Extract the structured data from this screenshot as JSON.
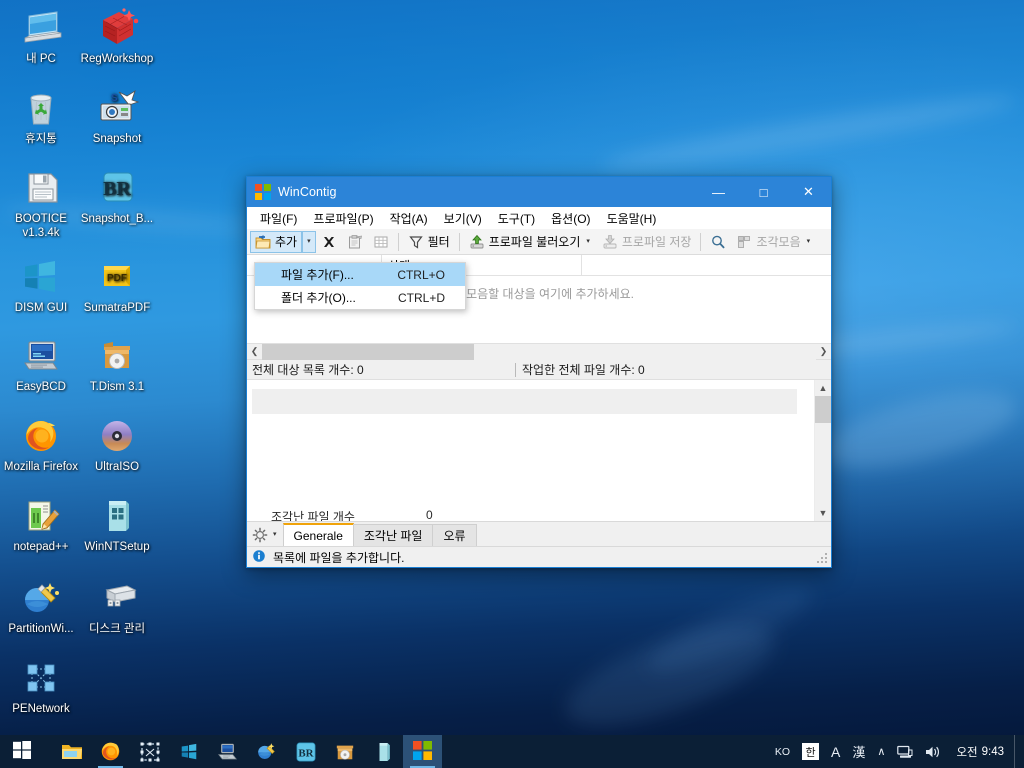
{
  "desktop": {
    "icons": [
      {
        "label": "내 PC",
        "icon": "computer-icon"
      },
      {
        "label": "RegWorkshop",
        "icon": "regworkshop-icon"
      },
      {
        "label": "휴지통",
        "icon": "recycle-bin-icon"
      },
      {
        "label": "Snapshot",
        "icon": "snapshot-icon"
      },
      {
        "label": "BOOTICE v1.3.4k",
        "icon": "bootice-icon"
      },
      {
        "label": "Snapshot_B...",
        "icon": "snapshot-br-icon"
      },
      {
        "label": "DISM GUI",
        "icon": "dism-gui-icon"
      },
      {
        "label": "SumatraPDF",
        "icon": "sumatrapdf-icon"
      },
      {
        "label": "EasyBCD",
        "icon": "easybcd-icon"
      },
      {
        "label": "T.Dism 3.1",
        "icon": "tdism-icon"
      },
      {
        "label": "Mozilla Firefox",
        "icon": "firefox-icon"
      },
      {
        "label": "UltraISO",
        "icon": "ultraiso-icon"
      },
      {
        "label": "notepad++",
        "icon": "notepadpp-icon"
      },
      {
        "label": "WinNTSetup",
        "icon": "winntsetup-icon"
      },
      {
        "label": "PartitionWi...",
        "icon": "partitionwizard-icon"
      },
      {
        "label": "디스크 관리",
        "icon": "disk-management-icon"
      },
      {
        "label": "PENetwork",
        "icon": "penetwork-icon"
      }
    ]
  },
  "window": {
    "title": "WinContig",
    "controls": {
      "minimize": "—",
      "maximize": "□",
      "close": "✕"
    },
    "menubar": [
      "파일(F)",
      "프로파일(P)",
      "작업(A)",
      "보기(V)",
      "도구(T)",
      "옵션(O)",
      "도움말(H)"
    ],
    "toolbar": {
      "add_label": "추가",
      "filter_label": "필터",
      "load_profile_label": "프로파일 불러오기",
      "save_profile_label": "프로파일 저장",
      "defrag_label": "조각모음",
      "caret": "▾"
    },
    "dropdown": {
      "items": [
        {
          "label": "파일 추가(F)...",
          "shortcut": "CTRL+O",
          "highlighted": true
        },
        {
          "label": "폴더 추가(O)...",
          "shortcut": "CTRL+D",
          "highlighted": false
        }
      ]
    },
    "list": {
      "columns": [
        "",
        "상태",
        ""
      ],
      "empty_message": "조각모음할 대상을 여기에 추가하세요."
    },
    "counts": {
      "total_items_label": "전체 대상 목록 개수:",
      "total_items_value": "0",
      "processed_files_label": "작업한 전체 파일 개수:",
      "processed_files_value": "0"
    },
    "detail": {
      "fragmented_label": "조각난 파일 개수",
      "fragmented_value": "0"
    },
    "tabs": [
      {
        "label": "Generale",
        "active": true
      },
      {
        "label": "조각난 파일",
        "active": false
      },
      {
        "label": "오류",
        "active": false
      }
    ],
    "statusbar": {
      "icon": "info-icon",
      "message": "목록에 파일을 추가합니다."
    }
  },
  "taskbar": {
    "start": "start-icon",
    "apps": [
      {
        "name": "file-explorer-icon"
      },
      {
        "name": "firefox-icon"
      },
      {
        "name": "snipping-tool-icon"
      },
      {
        "name": "dism-gui-icon"
      },
      {
        "name": "easybcd-icon"
      },
      {
        "name": "partitionwizard-icon"
      },
      {
        "name": "snapshot-br-icon"
      },
      {
        "name": "tdism-icon"
      },
      {
        "name": "winntsetup-icon"
      },
      {
        "name": "wincontig-icon"
      }
    ],
    "tray": {
      "lang": "KO",
      "ime_mode": "한",
      "alpha": "A",
      "hanja": "漢",
      "chevron": "∧",
      "network": "network-icon",
      "volume": "volume-icon",
      "time_period": "오전",
      "time": "9:43"
    }
  }
}
